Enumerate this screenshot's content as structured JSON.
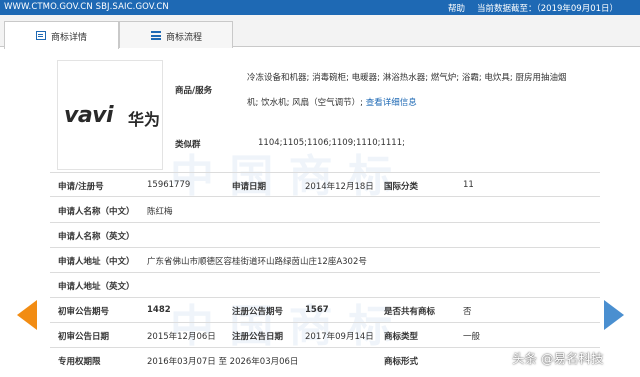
{
  "topbar": {
    "site": "WWW.CTMO.GOV.CN SBJ.SAIC.GOV.CN",
    "help": "帮助",
    "date": "当前数据截至：（2019年09月01日）"
  },
  "tabs": [
    {
      "label": "商标详情",
      "icon": "document-icon"
    },
    {
      "label": "商标流程",
      "icon": "list-icon"
    }
  ],
  "logo": {
    "latin": "VAVI",
    "cn": "华为"
  },
  "goods": {
    "label": "商品/服务",
    "line1": "冷冻设备和机器; 消毒碗柜; 电暖器; 淋浴热水器; 燃气炉; 浴霸; 电炊具; 厨房用抽油烟",
    "line2": "机; 饮水机; 风扇（空气调节）; ",
    "more": "查看详细信息"
  },
  "similar": {
    "label": "类似群",
    "value": "1104;1105;1106;1109;1110;1111;"
  },
  "rows": {
    "reg_no_label": "申请/注册号",
    "reg_no": "15961779",
    "apply_date_label": "申请日期",
    "apply_date": "2014年12月18日",
    "intl_class_label": "国际分类",
    "intl_class": "11",
    "applicant_cn_label": "申请人名称（中文）",
    "applicant_cn": "陈红梅",
    "applicant_en_label": "申请人名称（英文）",
    "address_cn_label": "申请人地址（中文）",
    "address_cn": "广东省佛山市顺德区容桂街道环山路绿茵山庄12座A302号",
    "address_en_label": "申请人地址（英文）",
    "prelim_no_label": "初审公告期号",
    "prelim_no": "1482",
    "reg_pub_no_label": "注册公告期号",
    "reg_pub_no": "1567",
    "shared_label": "是否共有商标",
    "shared": "否",
    "prelim_date_label": "初审公告日期",
    "prelim_date": "2015年12月06日",
    "reg_date_label": "注册公告日期",
    "reg_date": "2017年09月14日",
    "type_label": "商标类型",
    "type": "一般",
    "term_label": "专用权期限",
    "term": "2016年03月07日 至 2026年03月06日",
    "form_label": "商标形式"
  },
  "watermark": "头条 @易名科技"
}
